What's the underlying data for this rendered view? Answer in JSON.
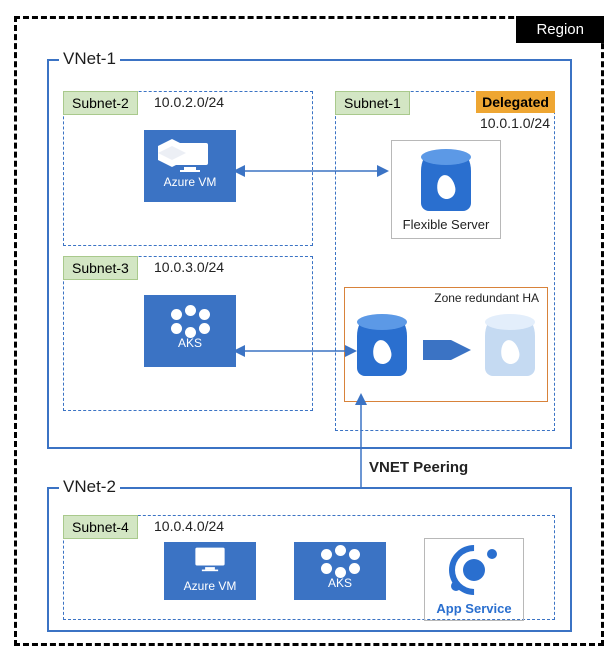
{
  "region_label": "Region",
  "vnet1": {
    "label": "VNet-1"
  },
  "vnet2": {
    "label": "VNet-2"
  },
  "subnets": {
    "s1": {
      "tag": "Subnet-1",
      "cidr": "10.0.1.0/24",
      "delegated": "Delegated"
    },
    "s2": {
      "tag": "Subnet-2",
      "cidr": "10.0.2.0/24"
    },
    "s3": {
      "tag": "Subnet-3",
      "cidr": "10.0.3.0/24"
    },
    "s4": {
      "tag": "Subnet-4",
      "cidr": "10.0.4.0/24"
    }
  },
  "resources": {
    "vm1": "Azure VM",
    "aks1": "AKS",
    "flex": "Flexible Server",
    "ha_label": "Zone redundant HA",
    "vm2": "Azure VM",
    "aks2": "AKS",
    "appsvc": "App Service"
  },
  "connections": {
    "peering": "VNET Peering"
  },
  "colors": {
    "azure_blue": "#3b73c4",
    "subnet_green": "#d3e6c4",
    "delegated_orange": "#eea632",
    "ha_border": "#d8823a"
  }
}
